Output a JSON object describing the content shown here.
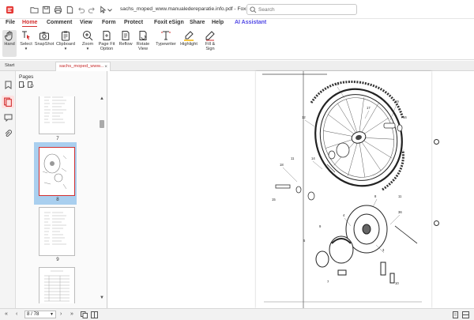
{
  "titlebar": {
    "doc_title": "sachs_moped_www.manualedereparatie.info.pdf - Foxit PDF Re...",
    "search_placeholder": "Search"
  },
  "menu": [
    "File",
    "Home",
    "Comment",
    "View",
    "Form",
    "Protect",
    "Foxit eSign",
    "Share",
    "Help",
    "AI Assistant"
  ],
  "menu_active": "Home",
  "ribbon": {
    "hand": "Hand",
    "select": "Select",
    "snapshot": "SnapShot",
    "clipboard": "Clipboard",
    "zoom": "Zoom",
    "pagefit1": "Page Fit",
    "pagefit2": "Option",
    "reflow": "Reflow",
    "rotate1": "Rotate",
    "rotate2": "View",
    "typewriter": "Typewriter",
    "highlight": "Highlight",
    "fill1": "Fill &",
    "fill2": "Sign"
  },
  "tabs": {
    "start": "Start",
    "doc": "sachs_moped_www...",
    "close": "×"
  },
  "panel": {
    "title": "Pages",
    "thumbs": [
      "7",
      "8",
      "9"
    ]
  },
  "status": {
    "page_value": "8 / 78"
  },
  "colors": {
    "accent": "#d32f2f",
    "ai": "#4f46e5",
    "selection": "#a9cfef"
  }
}
